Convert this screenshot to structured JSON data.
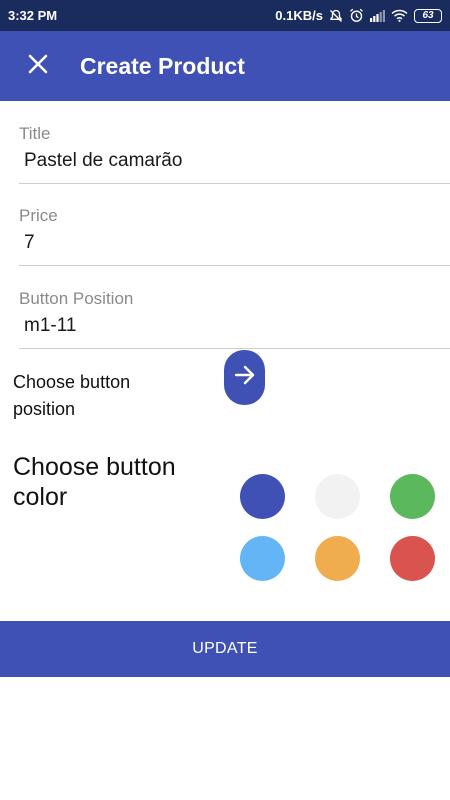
{
  "status_bar": {
    "time": "3:32 PM",
    "network_speed": "0.1KB/s",
    "battery_level": "63",
    "icons": [
      "mute-notifications-icon",
      "alarm-icon",
      "signal-icon",
      "wifi-icon",
      "battery-icon"
    ]
  },
  "app_bar": {
    "close_icon": "close-icon",
    "title": "Create Product"
  },
  "form": {
    "title_field": {
      "label": "Title",
      "value": "Pastel de camarão"
    },
    "price_field": {
      "label": "Price",
      "value": "7"
    },
    "position_field": {
      "label": "Button Position",
      "value": "m1-11"
    }
  },
  "position_picker": {
    "label": "Choose button position",
    "button_icon": "arrow-right-icon"
  },
  "color_picker": {
    "label": "Choose button color",
    "colors": [
      "#3f51b5",
      "#f2f2f2",
      "#5cb85c",
      "#64b5f6",
      "#f0ad4e",
      "#d9534f"
    ]
  },
  "actions": {
    "update_label": "UPDATE"
  },
  "theme": {
    "primary": "#3f51b5",
    "status_bar": "#1a2b5e"
  }
}
